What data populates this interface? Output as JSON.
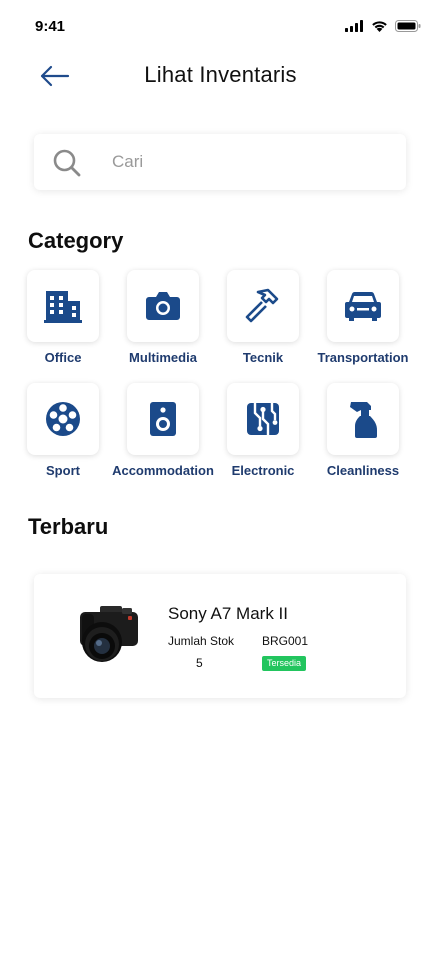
{
  "status_bar": {
    "time": "9:41"
  },
  "header": {
    "title": "Lihat Inventaris"
  },
  "search": {
    "placeholder": "Cari",
    "value": ""
  },
  "category": {
    "title": "Category",
    "items": [
      {
        "label": "Office",
        "icon": "building-icon"
      },
      {
        "label": "Multimedia",
        "icon": "camera-icon"
      },
      {
        "label": "Tecnik",
        "icon": "hammer-icon"
      },
      {
        "label": "Transportation",
        "icon": "car-icon"
      },
      {
        "label": "Sport",
        "icon": "soccer-ball-icon"
      },
      {
        "label": "Accommodation",
        "icon": "speaker-icon"
      },
      {
        "label": "Electronic",
        "icon": "circuit-icon"
      },
      {
        "label": "Cleanliness",
        "icon": "spray-bottle-icon"
      }
    ]
  },
  "latest": {
    "title": "Terbaru",
    "items": [
      {
        "name": "Sony A7 Mark II",
        "stock_label": "Jumlah Stok",
        "stock_value": "5",
        "code": "BRG001",
        "status": "Tersedia"
      }
    ]
  },
  "colors": {
    "accent": "#1f3b6e",
    "available": "#22c55e",
    "icon_blue": "#1b4a8a"
  }
}
